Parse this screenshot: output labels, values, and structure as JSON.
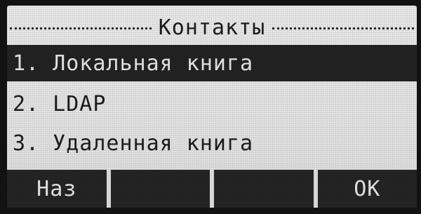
{
  "screen": {
    "title": "Контакты"
  },
  "menu": {
    "items": [
      {
        "label": "1. Локальная книга",
        "selected": true
      },
      {
        "label": "2. LDAP",
        "selected": false
      },
      {
        "label": "3. Удаленная книга",
        "selected": false
      }
    ]
  },
  "softkeys": {
    "key1": "Наз",
    "key2": "",
    "key3": "",
    "key4": "OK"
  },
  "colors": {
    "screen_background": "#e4e4e4",
    "highlight": "#222222",
    "text": "#1c1c1c"
  }
}
